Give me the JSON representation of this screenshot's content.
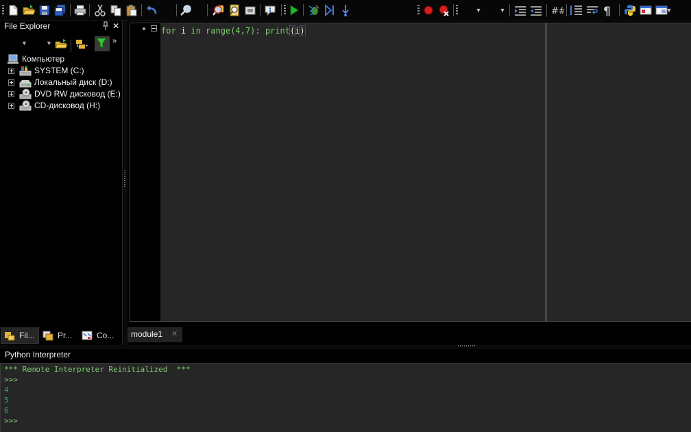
{
  "toolbar": {
    "icons": [
      "new-file-icon",
      "open-folder-icon",
      "save-icon",
      "save-all-icon",
      "print-icon",
      "cut-icon",
      "copy-icon",
      "paste-icon",
      "undo-icon",
      "find-icon",
      "find-in-files-icon",
      "replace-icon",
      "goto-icon",
      "info-icon",
      "run-icon",
      "debug-icon",
      "step-into-icon",
      "step-over-icon",
      "breakpoint-icon",
      "clear-breakpoints-icon",
      "indent-icon",
      "dedent-icon",
      "comment-icon",
      "list-icon",
      "wrap-icon",
      "pilcrow-icon",
      "python-icon",
      "window-icon",
      "layout-icon"
    ]
  },
  "file_explorer": {
    "title": "File Explorer",
    "tree": [
      {
        "label": "Компьютер",
        "icon": "computer-icon",
        "level": 0
      },
      {
        "label": "SYSTEM (C:)",
        "icon": "system-drive-icon",
        "level": 1
      },
      {
        "label": "Локальный диск (D:)",
        "icon": "hard-drive-icon",
        "level": 1
      },
      {
        "label": "DVD RW дисковод (E:)",
        "icon": "dvd-drive-icon",
        "level": 1
      },
      {
        "label": "CD-дисковод (H:)",
        "icon": "cd-drive-icon",
        "level": 1
      }
    ],
    "tabs": [
      {
        "label": "Fil...",
        "icon": "file-explorer-tab-icon",
        "active": true
      },
      {
        "label": "Pr...",
        "icon": "project-tab-icon",
        "active": false
      },
      {
        "label": "Co...",
        "icon": "code-explorer-tab-icon",
        "active": false
      }
    ]
  },
  "editor": {
    "code": {
      "t1": "for",
      "t2": " i ",
      "t3": "in",
      "t4": " range",
      "t5": "(",
      "t6": "4",
      "t7": ",",
      "t8": "7",
      "t9": "): ",
      "t10": "print",
      "t11": "(",
      "t12": "i",
      "t13": ")"
    },
    "tab_label": "module1",
    "tab_close": "✕"
  },
  "interpreter": {
    "title": "Python Interpreter",
    "lines": [
      {
        "text": "*** Remote Interpreter Reinitialized  ***",
        "color": "#7fcf6f"
      },
      {
        "text": ">>>",
        "color": "#7fcf6f"
      },
      {
        "text": "4",
        "color": "#2e9c9c"
      },
      {
        "text": "5",
        "color": "#2e9c9c"
      },
      {
        "text": "6",
        "color": "#2e9c9c"
      },
      {
        "text": ">>>",
        "color": "#7fcf6f"
      }
    ]
  },
  "colors": {
    "background": "#000000",
    "editor_bg": "#262626",
    "keyword_green": "#7fcf6f",
    "output_teal": "#2e9c9c"
  }
}
